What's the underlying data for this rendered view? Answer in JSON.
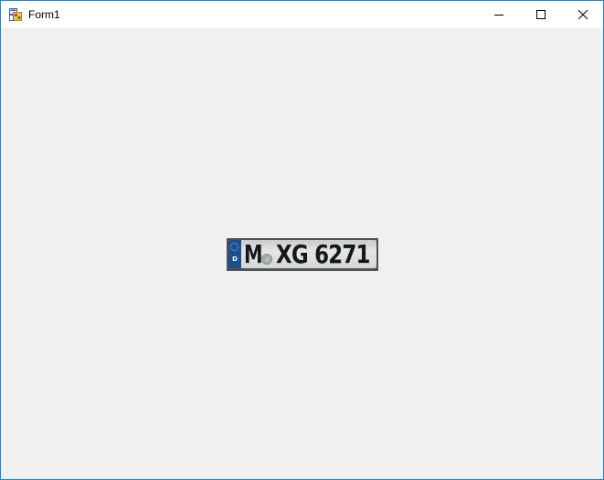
{
  "window": {
    "title": "Form1",
    "icon": "winforms-app-icon",
    "controls": {
      "minimize": "minimize-icon",
      "maximize": "maximize-icon",
      "close": "close-icon"
    }
  },
  "picture": {
    "plate": {
      "country_code": "D",
      "district": "M",
      "number": "XG 6271"
    }
  },
  "colors": {
    "window_border": "#1883d7",
    "client_background": "#f0f0f0",
    "plate_band": "#1b4f91"
  }
}
